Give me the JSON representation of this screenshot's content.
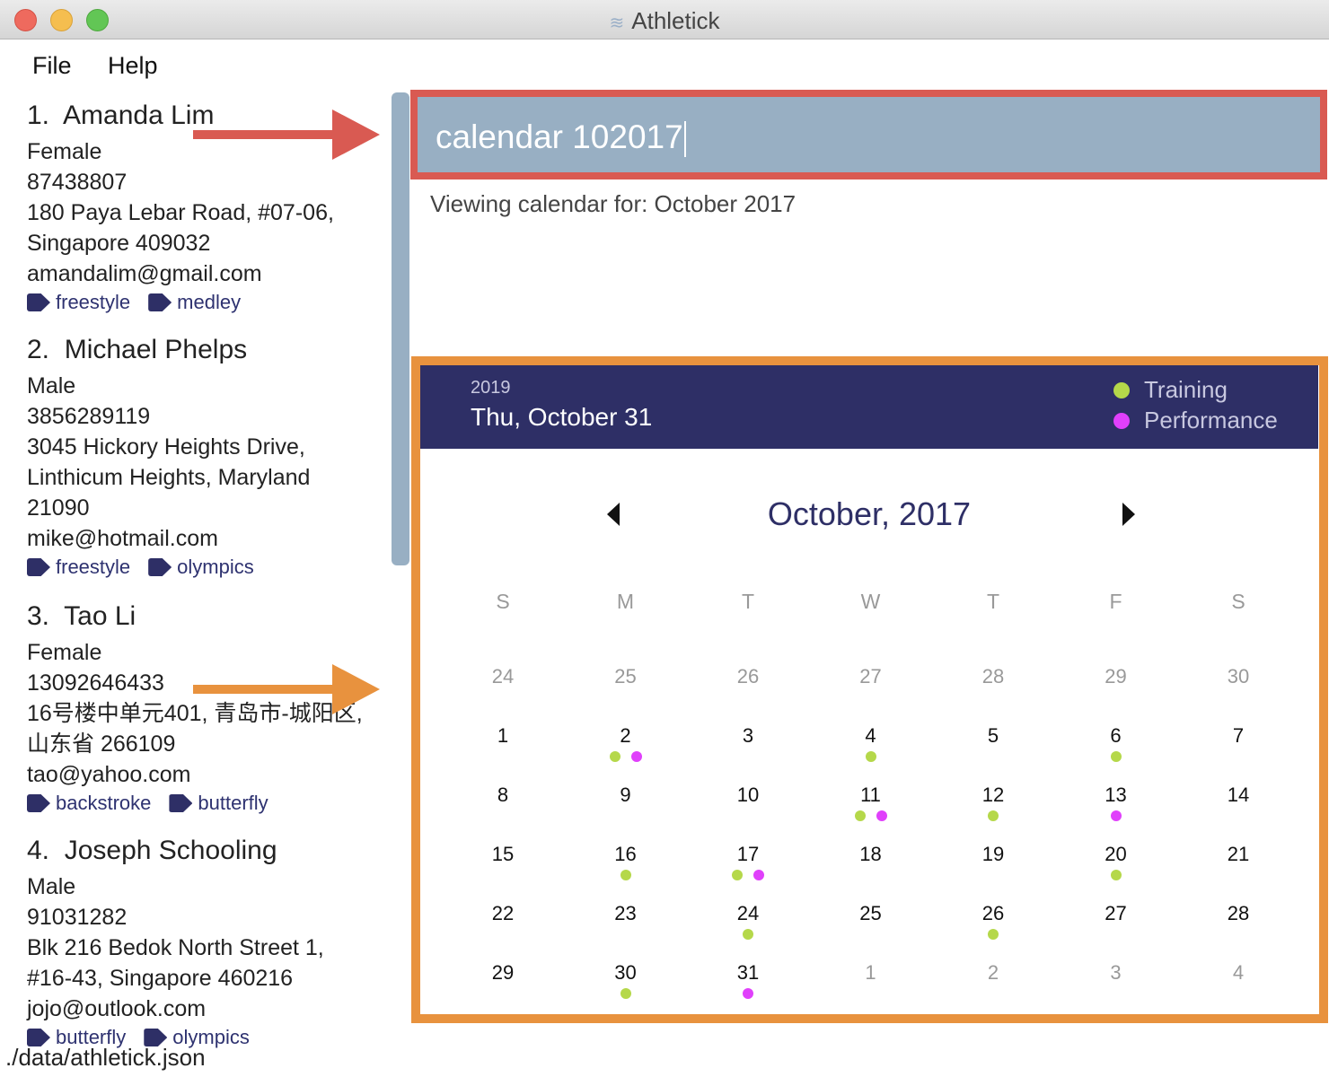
{
  "window": {
    "title": "Athletick",
    "icon": "swimmer-icon"
  },
  "menu": [
    "File",
    "Help"
  ],
  "people": [
    {
      "index": "1.",
      "name": "Amanda Lim",
      "lines": [
        "Female",
        "87438807",
        "180 Paya Lebar Road, #07-06,",
        "Singapore 409032",
        "amandalim@gmail.com"
      ],
      "tags": [
        "freestyle",
        "medley"
      ]
    },
    {
      "index": "2.",
      "name": "Michael Phelps",
      "lines": [
        "Male",
        "3856289119",
        "3045 Hickory Heights Drive,",
        "Linthicum Heights, Maryland",
        "21090",
        "mike@hotmail.com"
      ],
      "tags": [
        "freestyle",
        "olympics"
      ]
    },
    {
      "index": "3.",
      "name": "Tao Li",
      "lines": [
        "Female",
        "13092646433",
        "16号楼中单元401, 青岛市-城阳区,",
        "山东省 266109",
        "tao@yahoo.com"
      ],
      "tags": [
        "backstroke",
        "butterfly"
      ]
    },
    {
      "index": "4.",
      "name": "Joseph Schooling",
      "lines": [
        "Male",
        "91031282",
        "Blk 216 Bedok North Street 1,",
        "#16-43, Singapore 460216",
        "jojo@outlook.com"
      ],
      "tags": [
        "butterfly",
        "olympics"
      ]
    }
  ],
  "command": {
    "value": "calendar 102017"
  },
  "result": "Viewing calendar for: October 2017",
  "calendar": {
    "year": "2019",
    "selected_date": "Thu, October 31",
    "legend": [
      {
        "label": "Training",
        "color": "#b5d84a"
      },
      {
        "label": "Performance",
        "color": "#e040fb"
      }
    ],
    "month_title": "October, 2017",
    "weekdays": [
      "S",
      "M",
      "T",
      "W",
      "T",
      "F",
      "S"
    ],
    "prev_days": [
      24,
      25,
      26,
      27,
      28,
      29,
      30
    ],
    "days_in_month": 31,
    "next_days": [
      1,
      2,
      3,
      4
    ],
    "events": {
      "2": [
        "training",
        "performance"
      ],
      "4": [
        "training"
      ],
      "6": [
        "training"
      ],
      "11": [
        "training",
        "performance"
      ],
      "12": [
        "training"
      ],
      "13": [
        "performance"
      ],
      "16": [
        "training"
      ],
      "17": [
        "training",
        "performance"
      ],
      "20": [
        "training"
      ],
      "24": [
        "training"
      ],
      "26": [
        "training"
      ],
      "30": [
        "training"
      ],
      "31": [
        "performance"
      ]
    }
  },
  "colors": {
    "command_highlight": "#d95a52",
    "calendar_highlight": "#e8923e",
    "header": "#2e2f66",
    "training": "#b5d84a",
    "performance": "#e040fb"
  },
  "footer": "./data/athletick.json"
}
